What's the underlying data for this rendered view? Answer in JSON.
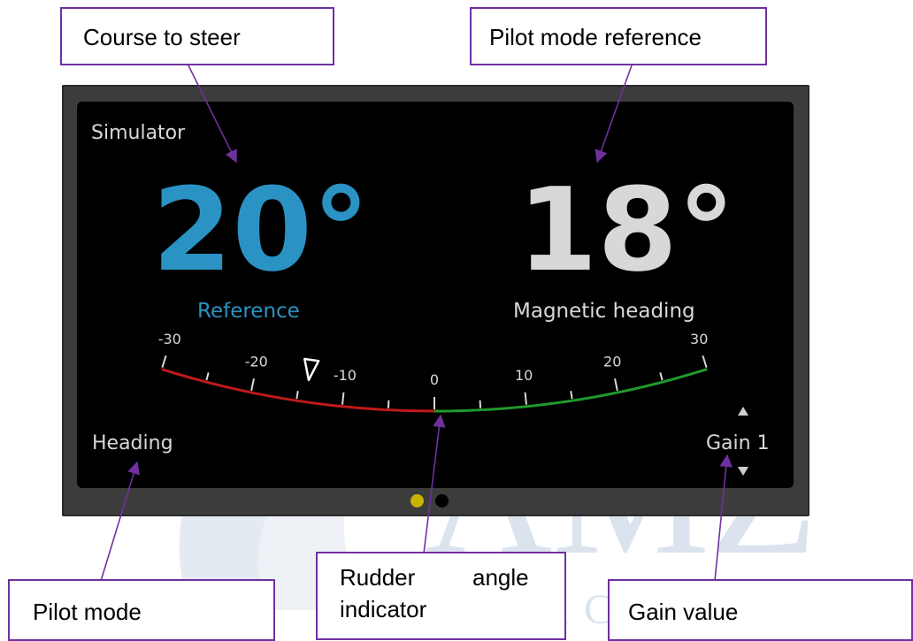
{
  "colors": {
    "reference": "#2a93c4",
    "heading": "#d8d8d8",
    "port": "#c0191b",
    "starboard": "#1f9a2d",
    "callout_border": "#7030a0",
    "page_dot_active": "#c8b400"
  },
  "watermark": {
    "logo": "AMZ",
    "sub": "YACHTING"
  },
  "screen": {
    "device_name": "Simulator",
    "reference_value": "20°",
    "reference_label": "Reference",
    "heading_value": "18°",
    "heading_label": "Magnetic heading",
    "pilot_mode": "Heading",
    "gain": "Gain 1",
    "page_count": 2,
    "active_page": 1
  },
  "rudder_gauge": {
    "min": -30,
    "max": 30,
    "tick_labels": [
      "-30",
      "-20",
      "-10",
      "0",
      "10",
      "20",
      "30"
    ],
    "rudder_angle": -14
  },
  "callouts": {
    "course_to_steer": "Course to steer",
    "pilot_mode_reference": "Pilot mode reference",
    "pilot_mode": "Pilot mode",
    "rudder_line1a": "Rudder",
    "rudder_line1b": "angle",
    "rudder_line2": "indicator",
    "gain_value": "Gain value"
  }
}
